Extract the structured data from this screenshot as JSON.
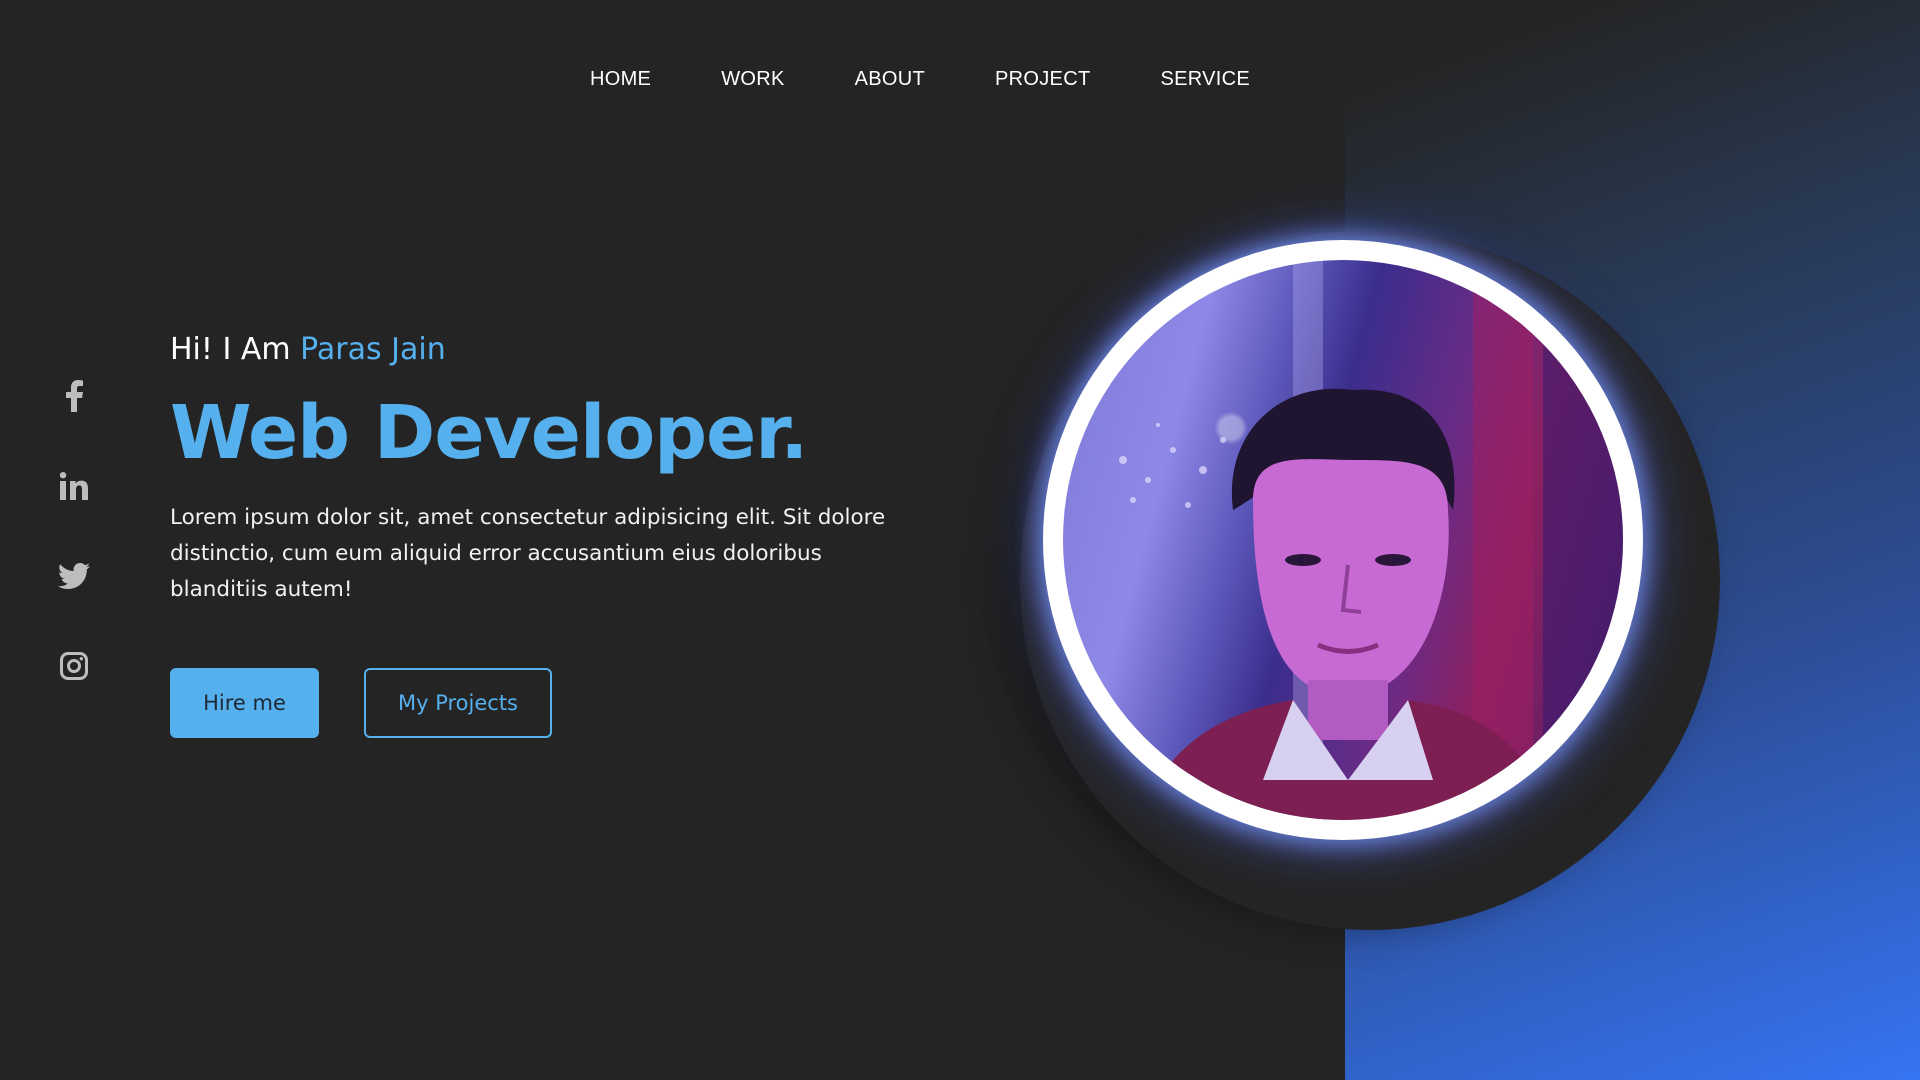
{
  "nav": {
    "items": [
      {
        "label": "HOME"
      },
      {
        "label": "WORK"
      },
      {
        "label": "ABOUT"
      },
      {
        "label": "PROJECT"
      },
      {
        "label": "SERVICE"
      }
    ]
  },
  "social": {
    "icons": [
      "facebook-icon",
      "linkedin-icon",
      "twitter-icon",
      "instagram-icon"
    ]
  },
  "hero": {
    "greeting_prefix": "Hi! I Am ",
    "name": "Paras Jain",
    "title": "Web Developer.",
    "description": "Lorem ipsum dolor sit, amet consectetur adipisicing elit. Sit dolore distinctio, cum eum aliquid error accusantium eius doloribus blanditiis autem!",
    "hire_label": "Hire me",
    "projects_label": "My Projects"
  },
  "colors": {
    "accent": "#55b0ed",
    "background": "#242424",
    "gradient_end": "#3574f3"
  }
}
